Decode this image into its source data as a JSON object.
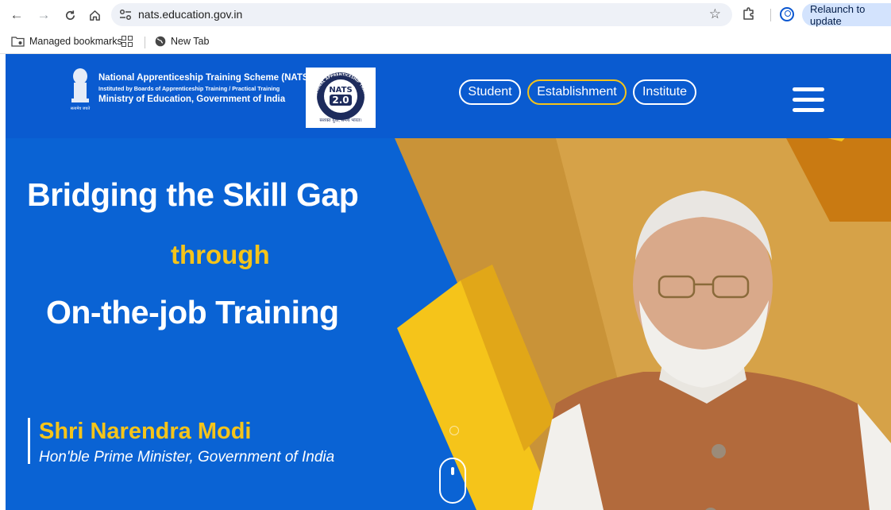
{
  "browser": {
    "url": "nats.education.gov.in",
    "relaunch_label": "Relaunch to update",
    "bookmarks": [
      {
        "label": "Managed bookmarks",
        "icon": "folder-managed-icon"
      },
      {
        "label": "New Tab",
        "icon": "globe-icon"
      }
    ]
  },
  "header": {
    "title": "National Apprenticeship Training Scheme (NATS)",
    "subtitle": "Instituted by Boards of Apprenticeship Training / Practical Training",
    "ministry": "Ministry of Education, Government of India",
    "emblem_caption": "सत्यमेव जयते",
    "logo_badge": "NATS",
    "logo_version": "2.0",
    "logo_ring_text": "NATIONAL APPRENTICESHIP TRAINING SCHEME",
    "logo_tagline": "सशक्त युवा, समर्थ भारत।",
    "nav": [
      {
        "label": "Student"
      },
      {
        "label": "Establishment"
      },
      {
        "label": "Institute"
      }
    ]
  },
  "hero": {
    "line1": "Bridging the Skill Gap",
    "line2": "through",
    "line3": "On-the-job Training",
    "person_name": "Shri Narendra Modi",
    "person_title": "Hon'ble Prime Minister, Government of India"
  },
  "colors": {
    "brand_blue": "#0a63d4",
    "accent_yellow": "#f5c41a",
    "accent_orange": "#d78a1c"
  }
}
